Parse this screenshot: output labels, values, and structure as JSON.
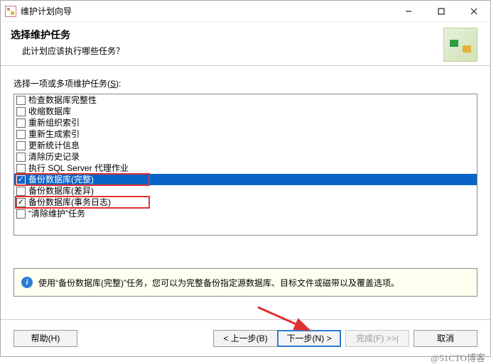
{
  "window": {
    "title": "维护计划向导"
  },
  "header": {
    "heading": "选择维护任务",
    "subtitle": "此计划应该执行哪些任务？"
  },
  "list": {
    "label_before_key": "选择一项或多项维护任务(",
    "label_key": "S",
    "label_after_key": "):",
    "items": [
      {
        "label": "检查数据库完整性",
        "checked": false,
        "selected": false
      },
      {
        "label": "收缩数据库",
        "checked": false,
        "selected": false
      },
      {
        "label": "重新组织索引",
        "checked": false,
        "selected": false
      },
      {
        "label": "重新生成索引",
        "checked": false,
        "selected": false
      },
      {
        "label": "更新统计信息",
        "checked": false,
        "selected": false
      },
      {
        "label": "清除历史记录",
        "checked": false,
        "selected": false
      },
      {
        "label": "执行 SQL Server 代理作业",
        "checked": false,
        "selected": false
      },
      {
        "label": "备份数据库(完整)",
        "checked": true,
        "selected": true
      },
      {
        "label": "备份数据库(差异)",
        "checked": false,
        "selected": false
      },
      {
        "label": "备份数据库(事务日志)",
        "checked": true,
        "selected": false
      },
      {
        "label": "“清除维护”任务",
        "checked": false,
        "selected": false
      }
    ]
  },
  "info": {
    "text": "使用“备份数据库(完整)”任务，您可以为完整备份指定源数据库、目标文件或磁带以及覆盖选项。"
  },
  "buttons": {
    "help": "帮助(H)",
    "back": "< 上一步(B)",
    "next": "下一步(N) >",
    "finish": "完成(F) >>|",
    "cancel": "取消"
  },
  "watermark": "@51CTO博客"
}
